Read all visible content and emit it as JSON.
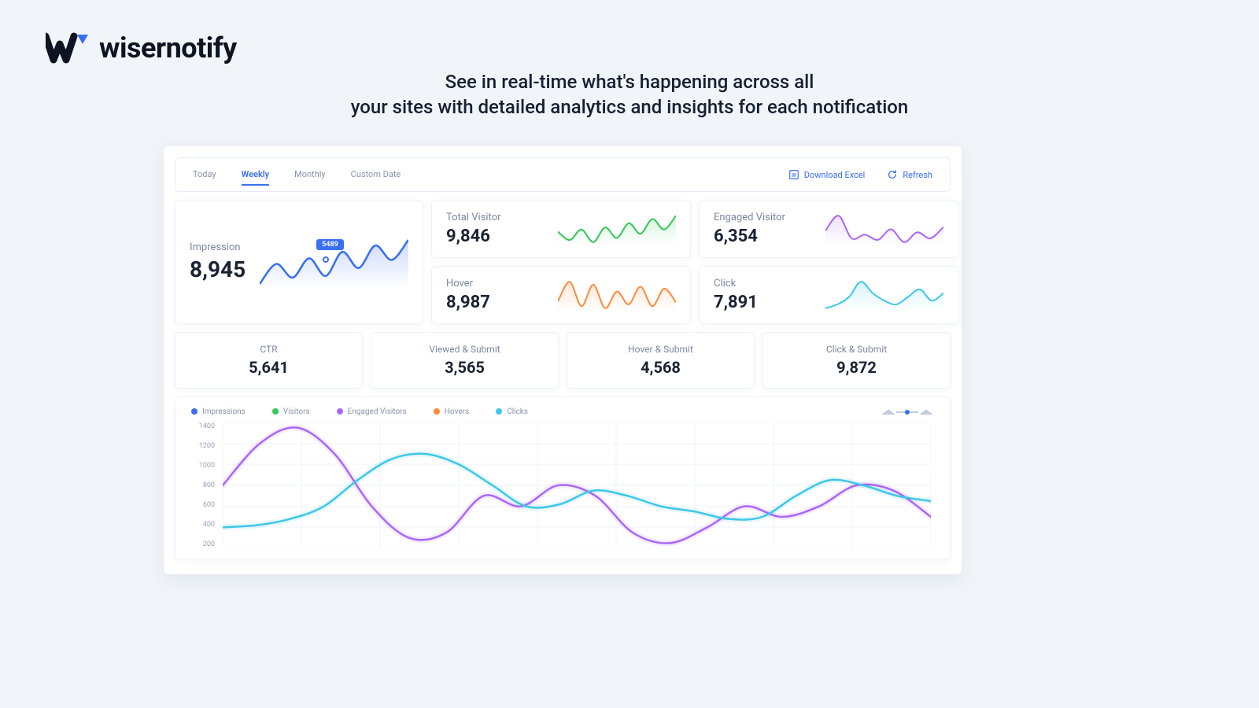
{
  "brand": {
    "name": "wisernotify"
  },
  "headline_line1": "See in real-time what's happening across all",
  "headline_line2": "your sites with detailed analytics and insights for each notification",
  "toolbar": {
    "tabs": [
      {
        "label": "Today",
        "active": false
      },
      {
        "label": "Weekly",
        "active": true
      },
      {
        "label": "Monthly",
        "active": false
      },
      {
        "label": "Custom Date",
        "active": false
      }
    ],
    "download_label": "Download Excel",
    "refresh_label": "Refresh"
  },
  "cards": {
    "impression": {
      "label": "Impression",
      "value": "8,945",
      "tooltip": "5489",
      "color": "#3a6ff2"
    },
    "total_visitor": {
      "label": "Total Visitor",
      "value": "9,846",
      "color": "#34c759"
    },
    "engaged_visitor": {
      "label": "Engaged Visitor",
      "value": "6,354",
      "color": "#a968f5"
    },
    "hover": {
      "label": "Hover",
      "value": "8,987",
      "color": "#ff8a3d"
    },
    "click": {
      "label": "Click",
      "value": "7,891",
      "color": "#3ec7e6"
    }
  },
  "stats": [
    {
      "label": "CTR",
      "value": "5,641"
    },
    {
      "label": "Viewed & Submit",
      "value": "3,565"
    },
    {
      "label": "Hover & Submit",
      "value": "4,568"
    },
    {
      "label": "Click & Submit",
      "value": "9,872"
    }
  ],
  "legend": [
    {
      "label": "Impressions",
      "color": "#3a6ff2"
    },
    {
      "label": "Visitors",
      "color": "#34c759"
    },
    {
      "label": "Engaged Visitors",
      "color": "#a968f5"
    },
    {
      "label": "Hovers",
      "color": "#ff8a3d"
    },
    {
      "label": "Clicks",
      "color": "#3ec7e6"
    }
  ],
  "chart_data": {
    "type": "line",
    "title": "",
    "xlabel": "",
    "ylabel": "",
    "ylim": [
      200,
      1400
    ],
    "y_ticks": [
      1400,
      1200,
      1000,
      800,
      600,
      400,
      200
    ],
    "x": [
      0,
      1,
      2,
      3,
      4,
      5,
      6,
      7,
      8,
      9,
      10,
      11
    ],
    "series": [
      {
        "name": "Engaged Visitors",
        "color": "#a968f5",
        "values": [
          800,
          1200,
          1350,
          1100,
          600,
          300,
          350,
          700,
          600,
          800,
          700,
          350,
          250,
          400,
          600,
          500,
          600,
          800,
          750,
          500
        ]
      },
      {
        "name": "Clicks",
        "color": "#3ec7e6",
        "values": [
          400,
          420,
          480,
          600,
          850,
          1050,
          1100,
          1000,
          800,
          600,
          620,
          750,
          700,
          600,
          550,
          480,
          500,
          700,
          850,
          800,
          700,
          650
        ]
      }
    ],
    "sparklines": {
      "impression": [
        30,
        55,
        38,
        62,
        40,
        70,
        50,
        78,
        60,
        85
      ],
      "total_visitor": [
        50,
        30,
        55,
        25,
        60,
        35,
        70,
        45,
        80,
        55,
        88
      ],
      "engaged_visitor": [
        60,
        80,
        50,
        55,
        48,
        62,
        45,
        58,
        50,
        65
      ],
      "hover": [
        45,
        65,
        40,
        62,
        38,
        55,
        42,
        60,
        40,
        58,
        44
      ],
      "click": [
        40,
        45,
        55,
        75,
        60,
        50,
        45,
        55,
        65,
        50,
        60
      ]
    }
  }
}
